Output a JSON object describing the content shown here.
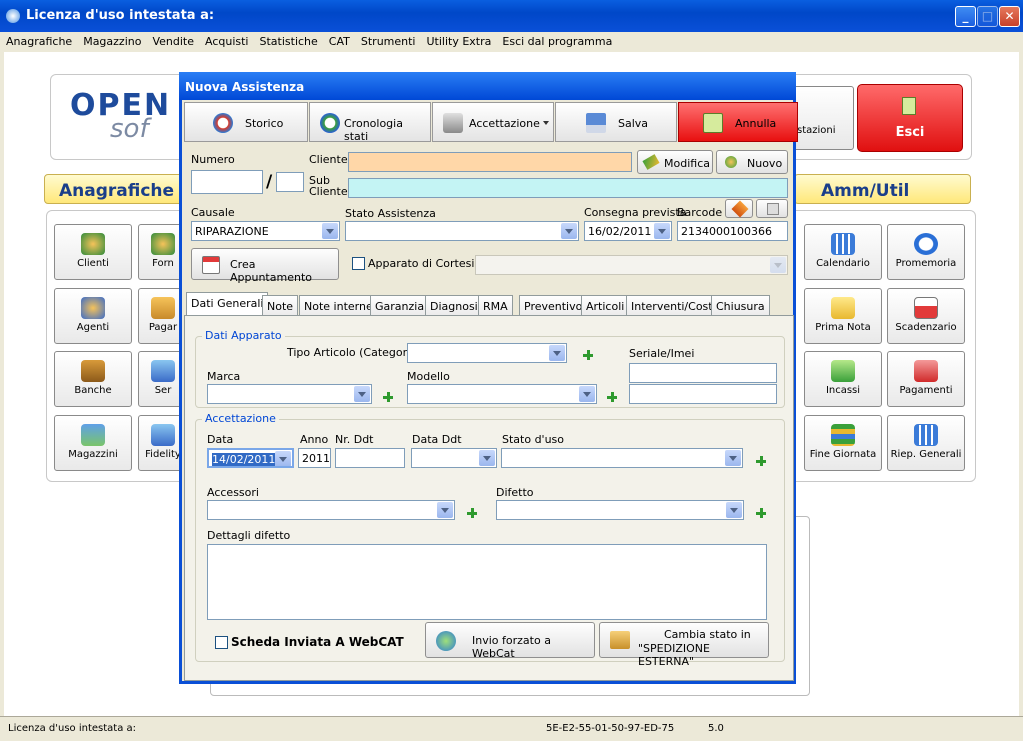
{
  "window": {
    "title": "Licenza d'uso intestata a:"
  },
  "menu": [
    "Anagrafiche",
    "Magazzino",
    "Vendite",
    "Acquisti",
    "Statistiche",
    "CAT",
    "Strumenti",
    "Utility Extra",
    "Esci dal programma"
  ],
  "background": {
    "logo_text": "OPEN",
    "logo_sub": "sof",
    "section_left": "Anagrafiche",
    "section_right": "Amm/Util",
    "top_buttons": {
      "impostazioni": "stazioni",
      "esci": "Esci"
    },
    "left_buttons": [
      "Clienti",
      "Agenti",
      "Banche",
      "Magazzini"
    ],
    "left_buttons2": [
      "Forn",
      "Pagar",
      "Ser",
      "Fidelity"
    ],
    "right_buttons": [
      "Calendario",
      "Promemoria",
      "Prima Nota",
      "Scadenzario",
      "Incassi",
      "Pagamenti",
      "Fine Giornata",
      "Riep. Generali"
    ]
  },
  "dialog": {
    "title": "Nuova Assistenza",
    "toolbar": {
      "storico": "Storico",
      "cronologia": "Cronologia stati",
      "accettazione": "Accettazione",
      "salva": "Salva",
      "annulla": "Annulla"
    },
    "labels": {
      "numero": "Numero",
      "cliente": "Cliente",
      "sub_cliente_1": "Sub",
      "sub_cliente_2": "Cliente",
      "modifica": "Modifica",
      "nuovo": "Nuovo",
      "causale": "Causale",
      "stato_assistenza": "Stato Assistenza",
      "consegna_prevista": "Consegna prevista",
      "barcode": "Barcode",
      "crea_appuntamento": "Crea Appuntamento",
      "apparato_cortesia": "Apparato di Cortesia"
    },
    "values": {
      "numero_sep": "/",
      "causale": "RIPARAZIONE",
      "consegna_prevista": "16/02/2011",
      "barcode": "2134000100366"
    },
    "tabs": [
      "Dati Generali",
      "Note",
      "Note interne",
      "Garanzia",
      "Diagnosi",
      "RMA",
      "Preventivo",
      "Articoli",
      "Interventi/Costi",
      "Chiusura"
    ],
    "dati_apparato": {
      "legend": "Dati Apparato",
      "tipo_articolo": "Tipo Articolo (Categoria)",
      "seriale": "Seriale/Imei",
      "marca": "Marca",
      "modello": "Modello"
    },
    "accettazione": {
      "legend": "Accettazione",
      "data": "Data",
      "anno": "Anno",
      "nr_ddt": "Nr. Ddt",
      "data_ddt": "Data Ddt",
      "stato_uso": "Stato d'uso",
      "accessori": "Accessori",
      "difetto": "Difetto",
      "dettagli_difetto": "Dettagli difetto",
      "data_value": "14/02/2011",
      "anno_value": "2011"
    },
    "footer": {
      "scheda_webcat": "Scheda Inviata A WebCAT",
      "invio_forzato": "Invio forzato a WebCat",
      "cambia_stato_1": "Cambia stato in",
      "cambia_stato_2": "\"SPEDIZIONE ESTERNA\""
    }
  },
  "status": {
    "licenza": "Licenza d'uso intestata a:",
    "code": "5E-E2-55-01-50-97-ED-75",
    "version": "5.0"
  }
}
